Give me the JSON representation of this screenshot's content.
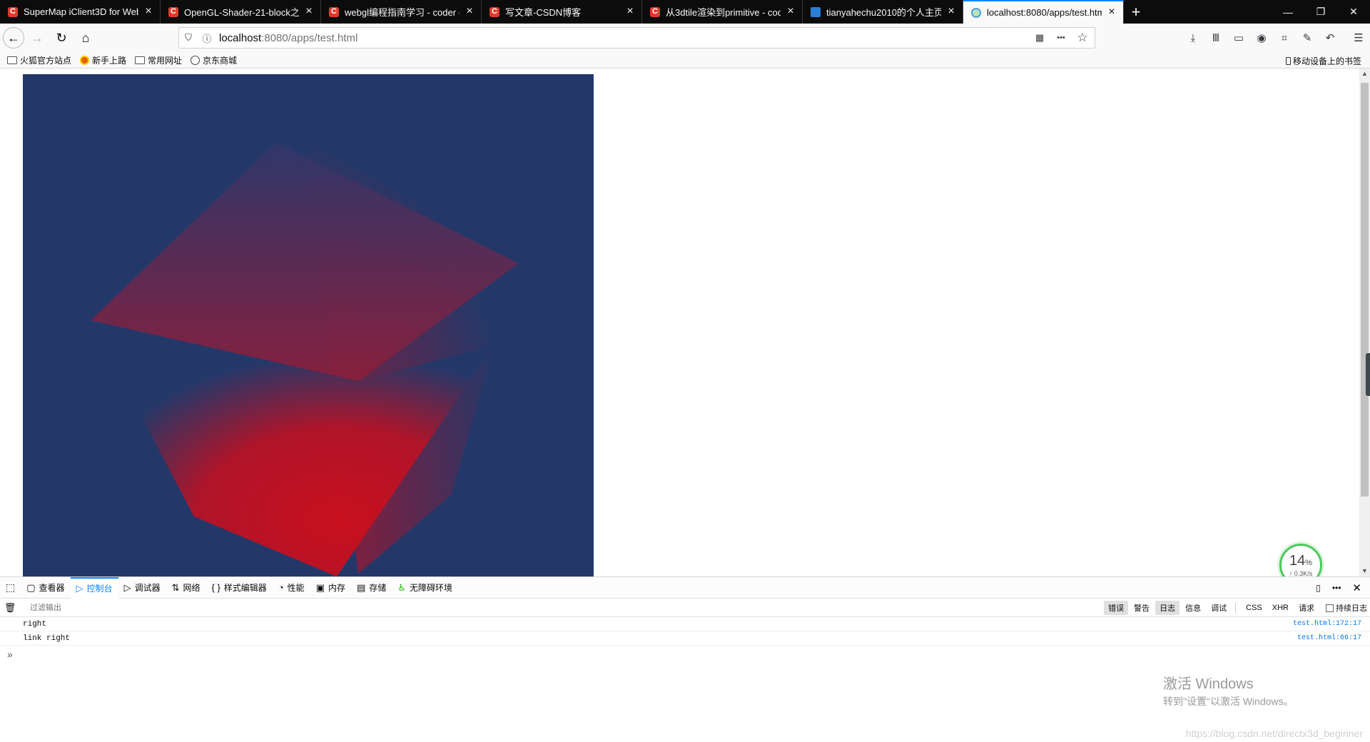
{
  "tabs": [
    {
      "title": "SuperMap iClient3D for Web",
      "icon": "csdn-c",
      "active": false
    },
    {
      "title": "OpenGL-Shader-21-block之",
      "icon": "csdn-c",
      "active": false
    },
    {
      "title": "webgl编程指南学习 - coder - ",
      "icon": "csdn-c",
      "active": false
    },
    {
      "title": "写文章-CSDN博客",
      "icon": "csdn-c",
      "active": false
    },
    {
      "title": "从3dtile渲染到primitive - cod",
      "icon": "csdn-c",
      "active": false
    },
    {
      "title": "tianyahechu2010的个人主页 - ",
      "icon": "blog",
      "active": false
    },
    {
      "title": "localhost:8080/apps/test.htm",
      "icon": "globe",
      "active": true
    }
  ],
  "newtab_symbol": "+",
  "window_controls": {
    "minimize": "—",
    "restore": "❐",
    "close": "✕"
  },
  "nav": {
    "back": "←",
    "forward": "→",
    "reload": "↻",
    "home": "⌂"
  },
  "url": {
    "host": "localhost",
    "path": ":8080/apps/test.html"
  },
  "url_icons": {
    "tracking": "⛉",
    "info": "ⓘ",
    "qr": "▦",
    "more": "•••",
    "bookmark": "☆"
  },
  "toolbar_icons": [
    "⤓",
    "Ⅲ",
    "▭",
    "◉",
    "⌗",
    "✎",
    "↶",
    "☰"
  ],
  "bookmarks": [
    {
      "label": "火狐官方站点",
      "icon": "folder"
    },
    {
      "label": "新手上路",
      "icon": "firefox"
    },
    {
      "label": "常用网址",
      "icon": "folder"
    },
    {
      "label": "京东商城",
      "icon": "globe"
    }
  ],
  "mobile_bookmarks": "移动设备上的书签",
  "speed_widget": {
    "percent": "14",
    "percent_sign": "%",
    "rate": "↑ 0.3K/s"
  },
  "devtools": {
    "tabs": [
      {
        "label": "查看器",
        "icon": "▢",
        "active": false
      },
      {
        "label": "控制台",
        "icon": "▷",
        "active": true
      },
      {
        "label": "调试器",
        "icon": "▷",
        "active": false
      },
      {
        "label": "网络",
        "icon": "⇅",
        "active": false
      },
      {
        "label": "样式编辑器",
        "icon": "{ }",
        "active": false
      },
      {
        "label": "性能",
        "icon": "◔",
        "active": false
      },
      {
        "label": "内存",
        "icon": "▣",
        "active": false
      },
      {
        "label": "存储",
        "icon": "▤",
        "active": false
      },
      {
        "label": "无障碍环境",
        "icon": "♿",
        "active": false
      }
    ],
    "filter_placeholder": "过滤输出",
    "filters": [
      {
        "label": "错误",
        "on": true
      },
      {
        "label": "警告",
        "on": false
      },
      {
        "label": "日志",
        "on": true
      },
      {
        "label": "信息",
        "on": false
      },
      {
        "label": "调试",
        "on": false
      }
    ],
    "request_filters": [
      "CSS",
      "XHR",
      "请求"
    ],
    "persist_label": "持续日志",
    "logs": [
      {
        "message": "right",
        "location": "test.html:172:17"
      },
      {
        "message": "link right",
        "location": "test.html:66:17"
      }
    ],
    "prompt": "»"
  },
  "watermark": {
    "title": "激活 Windows",
    "subtitle": "转到\"设置\"以激活 Windows。"
  },
  "csdn_link": "https://blog.csdn.net/directx3d_beginner"
}
